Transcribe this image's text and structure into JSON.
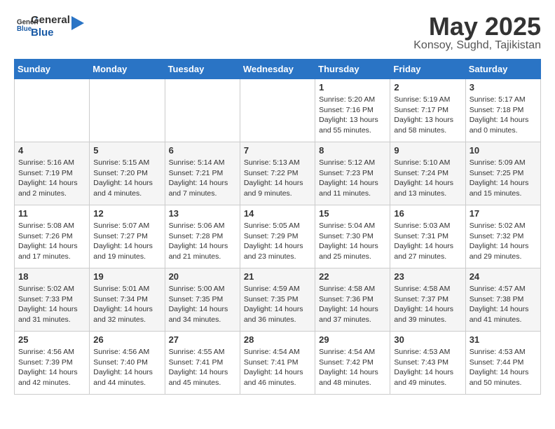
{
  "header": {
    "logo_general": "General",
    "logo_blue": "Blue",
    "month": "May 2025",
    "location": "Konsoy, Sughd, Tajikistan"
  },
  "days_of_week": [
    "Sunday",
    "Monday",
    "Tuesday",
    "Wednesday",
    "Thursday",
    "Friday",
    "Saturday"
  ],
  "weeks": [
    [
      {
        "day": "",
        "info": ""
      },
      {
        "day": "",
        "info": ""
      },
      {
        "day": "",
        "info": ""
      },
      {
        "day": "",
        "info": ""
      },
      {
        "day": "1",
        "info": "Sunrise: 5:20 AM\nSunset: 7:16 PM\nDaylight: 13 hours\nand 55 minutes."
      },
      {
        "day": "2",
        "info": "Sunrise: 5:19 AM\nSunset: 7:17 PM\nDaylight: 13 hours\nand 58 minutes."
      },
      {
        "day": "3",
        "info": "Sunrise: 5:17 AM\nSunset: 7:18 PM\nDaylight: 14 hours\nand 0 minutes."
      }
    ],
    [
      {
        "day": "4",
        "info": "Sunrise: 5:16 AM\nSunset: 7:19 PM\nDaylight: 14 hours\nand 2 minutes."
      },
      {
        "day": "5",
        "info": "Sunrise: 5:15 AM\nSunset: 7:20 PM\nDaylight: 14 hours\nand 4 minutes."
      },
      {
        "day": "6",
        "info": "Sunrise: 5:14 AM\nSunset: 7:21 PM\nDaylight: 14 hours\nand 7 minutes."
      },
      {
        "day": "7",
        "info": "Sunrise: 5:13 AM\nSunset: 7:22 PM\nDaylight: 14 hours\nand 9 minutes."
      },
      {
        "day": "8",
        "info": "Sunrise: 5:12 AM\nSunset: 7:23 PM\nDaylight: 14 hours\nand 11 minutes."
      },
      {
        "day": "9",
        "info": "Sunrise: 5:10 AM\nSunset: 7:24 PM\nDaylight: 14 hours\nand 13 minutes."
      },
      {
        "day": "10",
        "info": "Sunrise: 5:09 AM\nSunset: 7:25 PM\nDaylight: 14 hours\nand 15 minutes."
      }
    ],
    [
      {
        "day": "11",
        "info": "Sunrise: 5:08 AM\nSunset: 7:26 PM\nDaylight: 14 hours\nand 17 minutes."
      },
      {
        "day": "12",
        "info": "Sunrise: 5:07 AM\nSunset: 7:27 PM\nDaylight: 14 hours\nand 19 minutes."
      },
      {
        "day": "13",
        "info": "Sunrise: 5:06 AM\nSunset: 7:28 PM\nDaylight: 14 hours\nand 21 minutes."
      },
      {
        "day": "14",
        "info": "Sunrise: 5:05 AM\nSunset: 7:29 PM\nDaylight: 14 hours\nand 23 minutes."
      },
      {
        "day": "15",
        "info": "Sunrise: 5:04 AM\nSunset: 7:30 PM\nDaylight: 14 hours\nand 25 minutes."
      },
      {
        "day": "16",
        "info": "Sunrise: 5:03 AM\nSunset: 7:31 PM\nDaylight: 14 hours\nand 27 minutes."
      },
      {
        "day": "17",
        "info": "Sunrise: 5:02 AM\nSunset: 7:32 PM\nDaylight: 14 hours\nand 29 minutes."
      }
    ],
    [
      {
        "day": "18",
        "info": "Sunrise: 5:02 AM\nSunset: 7:33 PM\nDaylight: 14 hours\nand 31 minutes."
      },
      {
        "day": "19",
        "info": "Sunrise: 5:01 AM\nSunset: 7:34 PM\nDaylight: 14 hours\nand 32 minutes."
      },
      {
        "day": "20",
        "info": "Sunrise: 5:00 AM\nSunset: 7:35 PM\nDaylight: 14 hours\nand 34 minutes."
      },
      {
        "day": "21",
        "info": "Sunrise: 4:59 AM\nSunset: 7:35 PM\nDaylight: 14 hours\nand 36 minutes."
      },
      {
        "day": "22",
        "info": "Sunrise: 4:58 AM\nSunset: 7:36 PM\nDaylight: 14 hours\nand 37 minutes."
      },
      {
        "day": "23",
        "info": "Sunrise: 4:58 AM\nSunset: 7:37 PM\nDaylight: 14 hours\nand 39 minutes."
      },
      {
        "day": "24",
        "info": "Sunrise: 4:57 AM\nSunset: 7:38 PM\nDaylight: 14 hours\nand 41 minutes."
      }
    ],
    [
      {
        "day": "25",
        "info": "Sunrise: 4:56 AM\nSunset: 7:39 PM\nDaylight: 14 hours\nand 42 minutes."
      },
      {
        "day": "26",
        "info": "Sunrise: 4:56 AM\nSunset: 7:40 PM\nDaylight: 14 hours\nand 44 minutes."
      },
      {
        "day": "27",
        "info": "Sunrise: 4:55 AM\nSunset: 7:41 PM\nDaylight: 14 hours\nand 45 minutes."
      },
      {
        "day": "28",
        "info": "Sunrise: 4:54 AM\nSunset: 7:41 PM\nDaylight: 14 hours\nand 46 minutes."
      },
      {
        "day": "29",
        "info": "Sunrise: 4:54 AM\nSunset: 7:42 PM\nDaylight: 14 hours\nand 48 minutes."
      },
      {
        "day": "30",
        "info": "Sunrise: 4:53 AM\nSunset: 7:43 PM\nDaylight: 14 hours\nand 49 minutes."
      },
      {
        "day": "31",
        "info": "Sunrise: 4:53 AM\nSunset: 7:44 PM\nDaylight: 14 hours\nand 50 minutes."
      }
    ]
  ]
}
